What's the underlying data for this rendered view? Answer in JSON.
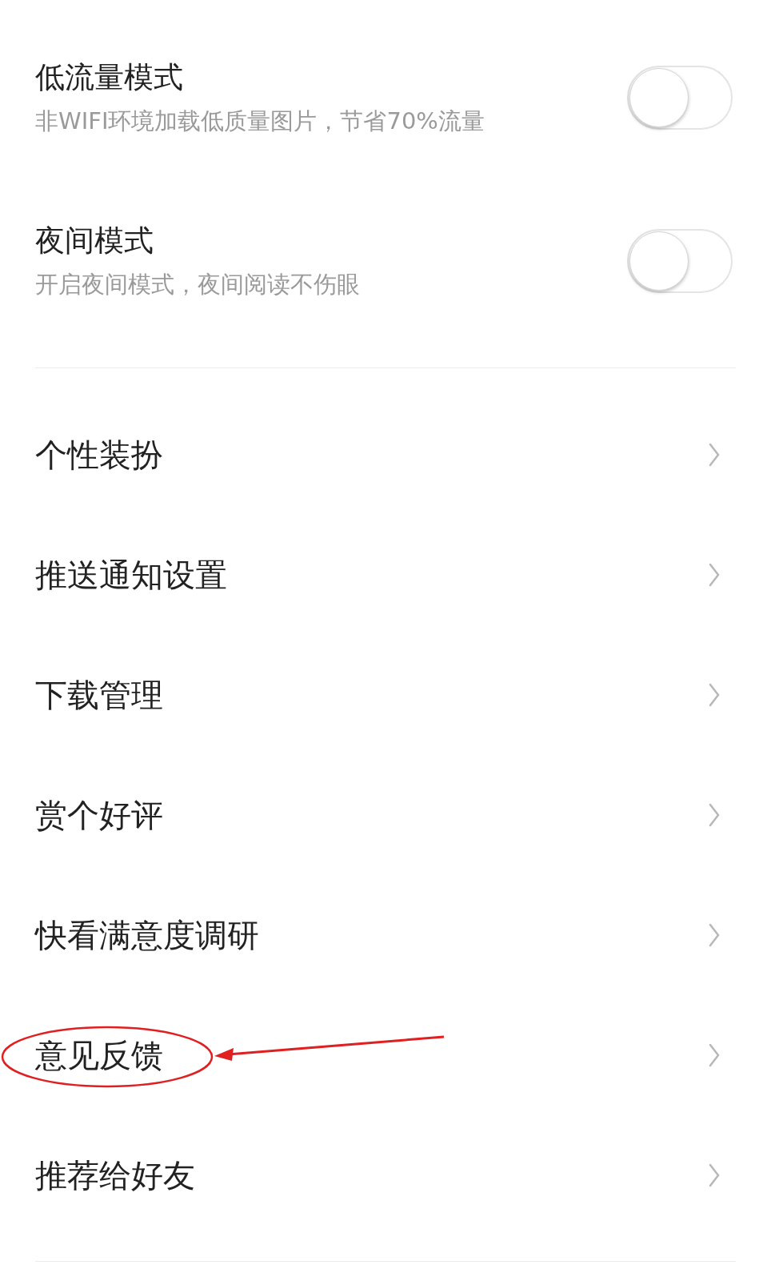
{
  "toggles": [
    {
      "title": "低流量模式",
      "subtitle": "非WIFI环境加载低质量图片，节省70%流量",
      "on": false
    },
    {
      "title": "夜间模式",
      "subtitle": "开启夜间模式，夜间阅读不伤眼",
      "on": false
    }
  ],
  "menu": [
    {
      "label": "个性装扮",
      "highlighted": false
    },
    {
      "label": "推送通知设置",
      "highlighted": false
    },
    {
      "label": "下载管理",
      "highlighted": false
    },
    {
      "label": "赏个好评",
      "highlighted": false
    },
    {
      "label": "快看满意度调研",
      "highlighted": false
    },
    {
      "label": "意见反馈",
      "highlighted": true
    },
    {
      "label": "推荐给好友",
      "highlighted": false
    }
  ]
}
